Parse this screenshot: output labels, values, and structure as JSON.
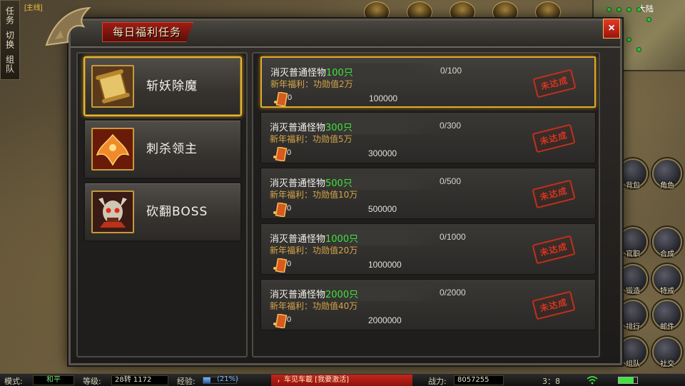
{
  "hud": {
    "left_tabs": [
      "任务",
      "切换",
      "组队"
    ],
    "mainline_tag": "[主线]",
    "minimap_label": "大陆",
    "side_buttons": [
      "背包",
      "角色",
      "官职",
      "合成",
      "锻造",
      "特戒",
      "排行",
      "邮件",
      "组队",
      "社交"
    ]
  },
  "status": {
    "mode_label": "模式:",
    "mode_value": "和平",
    "level_label": "等级:",
    "level_value": "28转  1172",
    "exp_label": "经验:",
    "exp_percent": "(21%)",
    "exp_fraction": 0.21,
    "chat_text": "，车见车載 [我要激活]",
    "power_label": "战力:",
    "power_value": "8057255",
    "time": "3：8"
  },
  "dialog": {
    "title": "每日福利任务",
    "close_label": "×",
    "categories": [
      {
        "label": "斩妖除魔",
        "icon": "scroll-icon",
        "selected": true
      },
      {
        "label": "刺杀领主",
        "icon": "phoenix-icon",
        "selected": false
      },
      {
        "label": "砍翻BOSS",
        "icon": "skull-demon-icon",
        "selected": false
      }
    ],
    "tasks": [
      {
        "title": "消灭普通怪物",
        "count": "100只",
        "reward": "新年福利：功勋值2万",
        "progress": "0/100",
        "tickets": "0",
        "merit": "100000",
        "status": "未达成"
      },
      {
        "title": "消灭普通怪物",
        "count": "300只",
        "reward": "新年福利：功勋值5万",
        "progress": "0/300",
        "tickets": "0",
        "merit": "300000",
        "status": "未达成"
      },
      {
        "title": "消灭普通怪物",
        "count": "500只",
        "reward": "新年福利：功勋值10万",
        "progress": "0/500",
        "tickets": "0",
        "merit": "500000",
        "status": "未达成"
      },
      {
        "title": "消灭普通怪物",
        "count": "1000只",
        "reward": "新年福利：功勋值20万",
        "progress": "0/1000",
        "tickets": "0",
        "merit": "1000000",
        "status": "未达成"
      },
      {
        "title": "消灭普通怪物",
        "count": "2000只",
        "reward": "新年福利：功勋值40万",
        "progress": "0/2000",
        "tickets": "0",
        "merit": "2000000",
        "status": "未达成"
      }
    ]
  },
  "colors": {
    "accent_gold": "#e0a92e",
    "count_green": "#3fe33f",
    "reward_gold": "#d4a64a",
    "stamp_red": "#d9351f"
  }
}
